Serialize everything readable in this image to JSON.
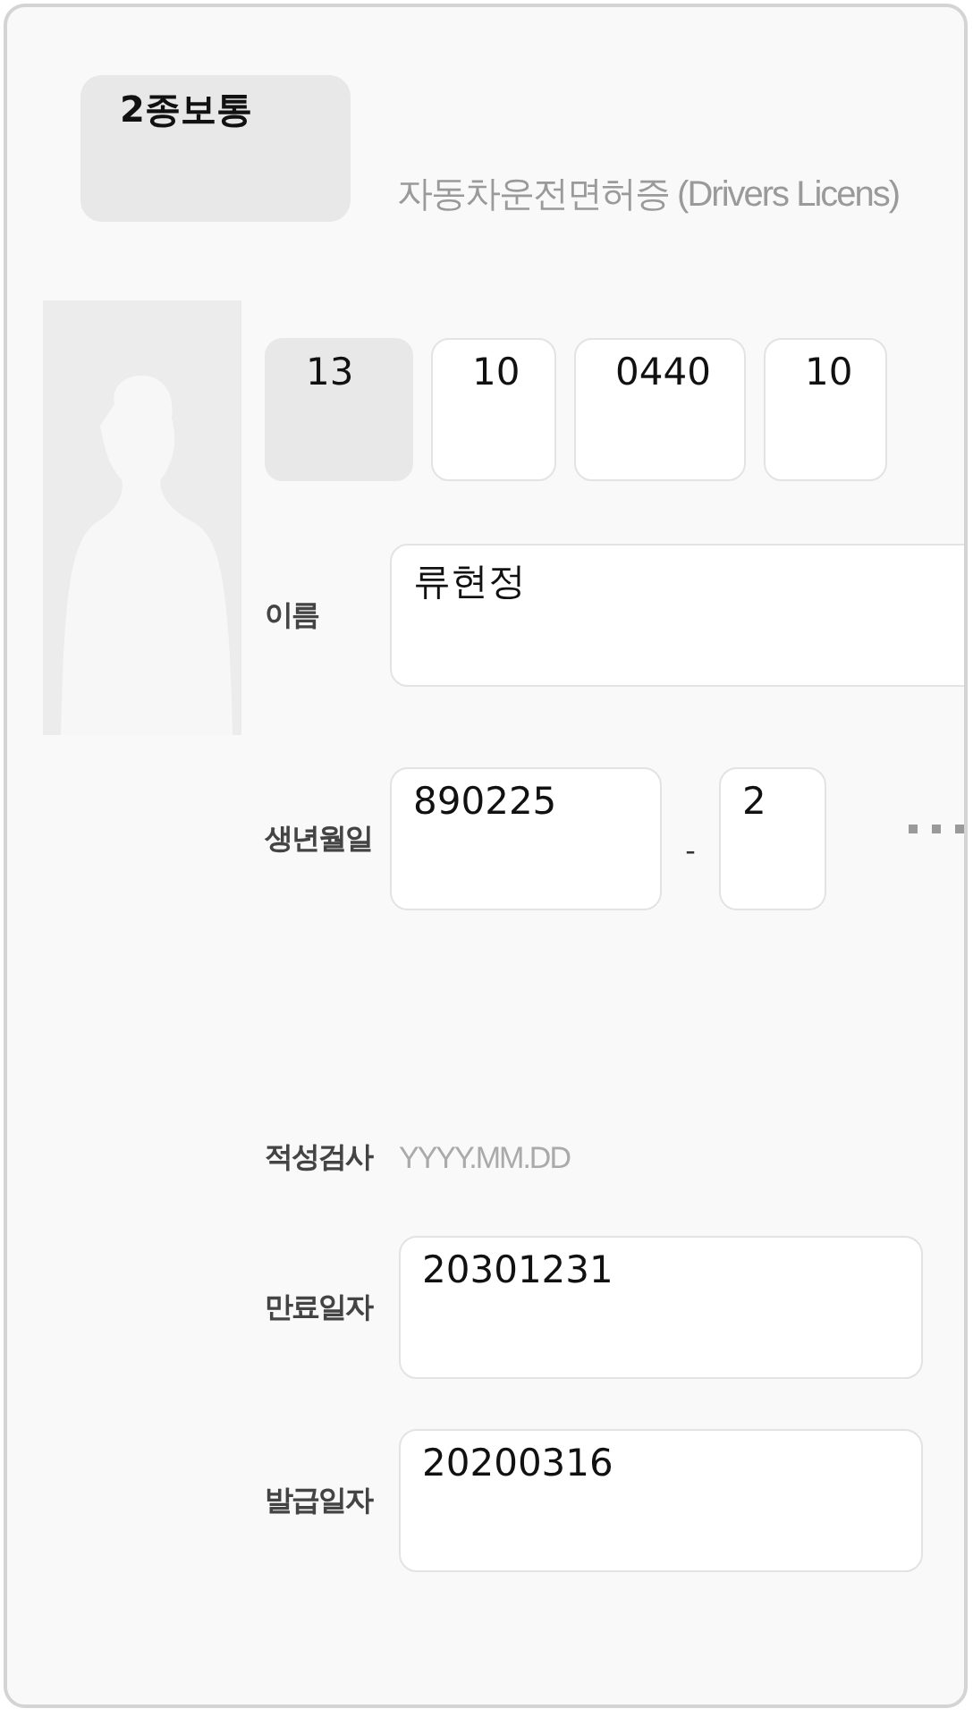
{
  "license_type": "2종보통",
  "title": "자동차운전면허증 (Drivers Licens)",
  "license_number": [
    {
      "value": "13",
      "disabled": true
    },
    {
      "value": "10",
      "disabled": false
    },
    {
      "value": "0440",
      "disabled": false
    },
    {
      "value": "10",
      "disabled": false
    }
  ],
  "name": {
    "label": "이름",
    "value": "류현정"
  },
  "birth": {
    "label": "생년월일",
    "value": "890225",
    "separator": "-",
    "suffix": "2"
  },
  "aptitude": {
    "label": "적성검사",
    "placeholder": "YYYY.MM.DD"
  },
  "dates": [
    {
      "label": "만료일자",
      "value": "20301231"
    },
    {
      "label": "발급일자",
      "value": "20200316"
    }
  ]
}
